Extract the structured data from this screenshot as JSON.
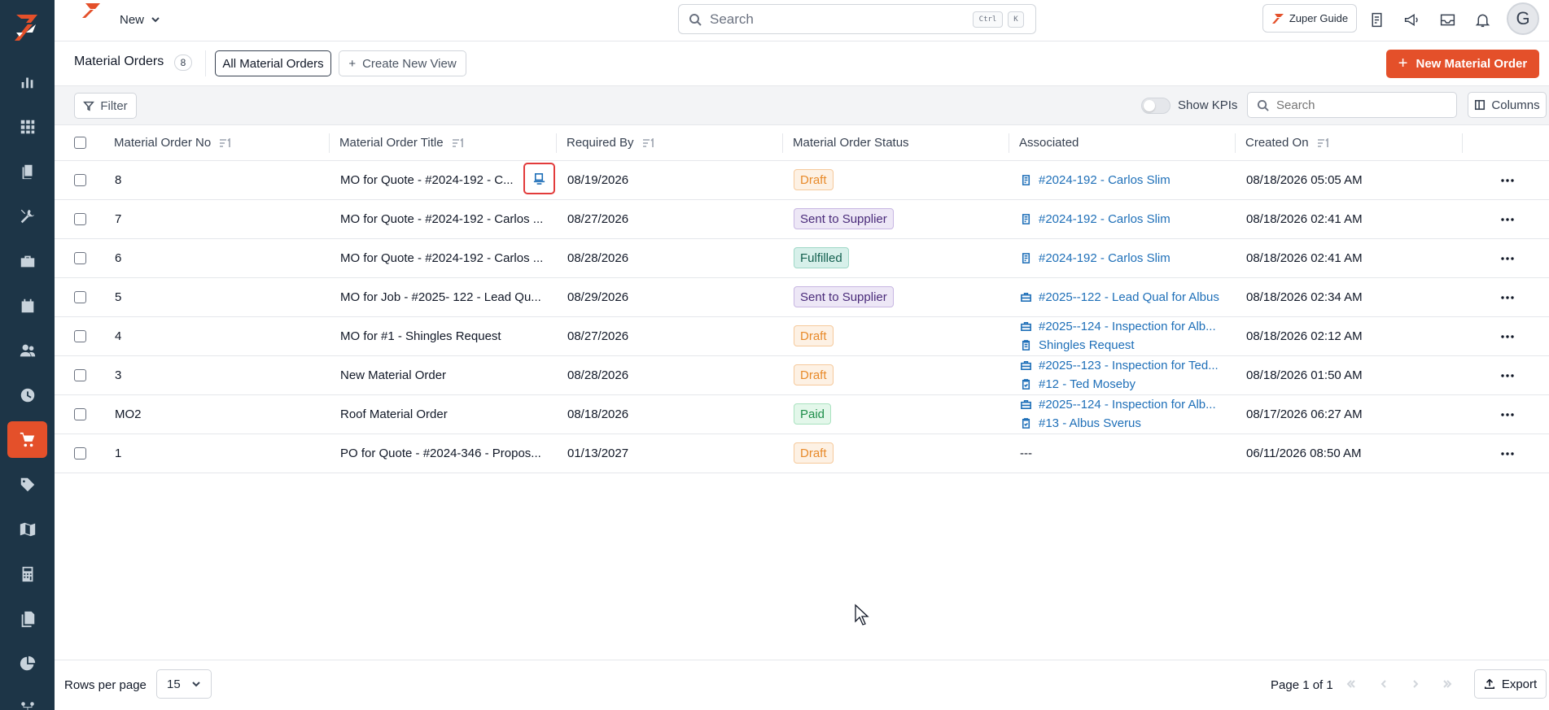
{
  "colors": {
    "sidebar_bg": "#1d3547",
    "brand_orange": "#e4502a",
    "link_blue": "#1e6fb8",
    "highlight_red": "#e23b3b"
  },
  "sidebar": {
    "items": [
      {
        "icon": "bar-chart-icon",
        "label": "Reports"
      },
      {
        "icon": "dashboard-grid-icon",
        "label": "Dashboard"
      },
      {
        "icon": "quotes-icon",
        "label": "Quotes"
      },
      {
        "icon": "tools-icon",
        "label": "Jobs"
      },
      {
        "icon": "briefcase-icon",
        "label": "Projects"
      },
      {
        "icon": "calendar-icon",
        "label": "Schedule"
      },
      {
        "icon": "users-icon",
        "label": "Customers"
      },
      {
        "icon": "clock-icon",
        "label": "Timesheets"
      },
      {
        "icon": "cart-icon",
        "label": "Material Orders",
        "active": true
      },
      {
        "icon": "tag-icon",
        "label": "Products"
      },
      {
        "icon": "map-icon",
        "label": "Map"
      },
      {
        "icon": "calculator-icon",
        "label": "Estimates"
      },
      {
        "icon": "documents-icon",
        "label": "Documents"
      },
      {
        "icon": "pie-chart-icon",
        "label": "Analytics"
      },
      {
        "icon": "workflow-icon",
        "label": "Workflows"
      }
    ]
  },
  "topbar": {
    "new_label": "New",
    "search_placeholder": "Search",
    "shortcut_ctrl": "Ctrl",
    "shortcut_key": "K",
    "guide_label": "Zuper Guide",
    "avatar_initial": "G"
  },
  "page": {
    "title": "Material Orders",
    "count": "8",
    "active_view": "All Material Orders",
    "create_view_label": "Create New View",
    "new_button_label": "New Material Order"
  },
  "toolbar": {
    "filter_label": "Filter",
    "kpi_label": "Show KPIs",
    "kpi_enabled": false,
    "search_placeholder": "Search",
    "columns_label": "Columns"
  },
  "table": {
    "columns": [
      "Material Order No",
      "Material Order Title",
      "Required By",
      "Material Order Status",
      "Associated",
      "Created On"
    ],
    "rows": [
      {
        "no": "8",
        "title": "MO for Quote - #2024-192 - C...",
        "required_by": "08/19/2026",
        "status": "Draft",
        "status_kind": "draft",
        "associated": [
          {
            "icon": "quote-doc-icon",
            "text": "#2024-192 - Carlos Slim"
          }
        ],
        "created_on": "08/18/2026 05:05 AM"
      },
      {
        "no": "7",
        "title": "MO for Quote - #2024-192 - Carlos ...",
        "required_by": "08/27/2026",
        "status": "Sent to Supplier",
        "status_kind": "sent",
        "associated": [
          {
            "icon": "quote-doc-icon",
            "text": "#2024-192 - Carlos Slim"
          }
        ],
        "created_on": "08/18/2026 02:41 AM"
      },
      {
        "no": "6",
        "title": "MO for Quote - #2024-192 - Carlos ...",
        "required_by": "08/28/2026",
        "status": "Fulfilled",
        "status_kind": "fulfilled",
        "associated": [
          {
            "icon": "quote-doc-icon",
            "text": "#2024-192 - Carlos Slim"
          }
        ],
        "created_on": "08/18/2026 02:41 AM"
      },
      {
        "no": "5",
        "title": "MO for Job - #2025- 122 - Lead Qu...",
        "required_by": "08/29/2026",
        "status": "Sent to Supplier",
        "status_kind": "sent",
        "associated": [
          {
            "icon": "job-briefcase-icon",
            "text": "#2025--122 - Lead Qual for Albus"
          }
        ],
        "created_on": "08/18/2026 02:34 AM"
      },
      {
        "no": "4",
        "title": "MO for #1 - Shingles Request",
        "required_by": "08/27/2026",
        "status": "Draft",
        "status_kind": "draft",
        "associated": [
          {
            "icon": "job-briefcase-icon",
            "text": "#2025--124 - Inspection for Alb..."
          },
          {
            "icon": "request-clipboard-icon",
            "text": "Shingles Request"
          }
        ],
        "created_on": "08/18/2026 02:12 AM"
      },
      {
        "no": "3",
        "title": "New Material Order",
        "required_by": "08/28/2026",
        "status": "Draft",
        "status_kind": "draft",
        "associated": [
          {
            "icon": "job-briefcase-icon",
            "text": "#2025--123 - Inspection for Ted..."
          },
          {
            "icon": "checklist-clipboard-icon",
            "text": "#12 - Ted Moseby"
          }
        ],
        "created_on": "08/18/2026 01:50 AM"
      },
      {
        "no": "MO2",
        "title": "Roof Material Order",
        "required_by": "08/18/2026",
        "status": "Paid",
        "status_kind": "paid",
        "associated": [
          {
            "icon": "job-briefcase-icon",
            "text": "#2025--124 - Inspection for Alb..."
          },
          {
            "icon": "checklist-clipboard-icon",
            "text": "#13 - Albus Sverus"
          }
        ],
        "created_on": "08/17/2026 06:27 AM"
      },
      {
        "no": "1",
        "title": "PO for Quote - #2024-346 - Propos...",
        "required_by": "01/13/2027",
        "status": "Draft",
        "status_kind": "draft",
        "associated": [],
        "associated_empty": "---",
        "created_on": "06/11/2026 08:50 AM"
      }
    ]
  },
  "footer": {
    "rows_per_page_label": "Rows per page",
    "rows_per_page_value": "15",
    "page_info": "Page 1 of 1",
    "export_label": "Export"
  }
}
